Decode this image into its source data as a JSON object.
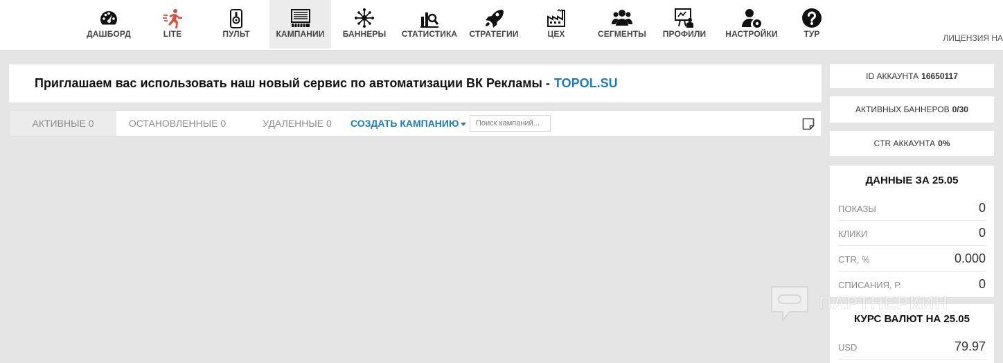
{
  "nav": {
    "items": [
      {
        "label": "ДАШБОРД",
        "icon": "dashboard-gauge-icon"
      },
      {
        "label": "LITE",
        "icon": "runner-icon"
      },
      {
        "label": "ПУЛЬТ",
        "icon": "remote-control-icon"
      },
      {
        "label": "КАМПАНИИ",
        "icon": "campaigns-board-icon",
        "active": true
      },
      {
        "label": "БАННЕРЫ",
        "icon": "banners-network-icon"
      },
      {
        "label": "СТАТИСТИКА",
        "icon": "statistics-chart-icon"
      },
      {
        "label": "СТРАТЕГИИ",
        "icon": "rocket-icon"
      },
      {
        "label": "ЦЕХ",
        "icon": "factory-icon"
      },
      {
        "label": "СЕГМЕНТЫ",
        "icon": "users-group-icon"
      },
      {
        "label": "ПРОФИЛИ",
        "icon": "profile-presentation-icon"
      },
      {
        "label": "НАСТРОЙКИ",
        "icon": "user-settings-icon"
      },
      {
        "label": "ТУР",
        "icon": "question-icon"
      }
    ],
    "license_label": "ЛИЦЕНЗИЯ НА"
  },
  "announcement": {
    "text": "Приглашаем вас использовать наш новый сервис по автоматизации ВК Рекламы -",
    "link": "TOPOL.SU"
  },
  "tabs": {
    "active": "АКТИВНЫЕ 0",
    "stopped": "ОСТАНОВЛЕННЫЕ 0",
    "deleted": "УДАЛЕННЫЕ 0",
    "create": "СОЗДАТЬ КАМПАНИЮ",
    "search_placeholder": "Поиск кампаний..."
  },
  "account": {
    "id_label": "ID АККАУНТА",
    "id_value": "16650117",
    "banners_label": "АКТИВНЫХ БАННЕРОВ",
    "banners_value": "0/30",
    "ctr_label": "CTR АККАУНТА",
    "ctr_value": "0%"
  },
  "day_data": {
    "title": "ДАННЫЕ ЗА 25.05",
    "rows": [
      {
        "label": "ПОКАЗЫ",
        "value": "0"
      },
      {
        "label": "КЛИКИ",
        "value": "0"
      },
      {
        "label": "CTR, %",
        "value": "0.000"
      },
      {
        "label": "СПИСАНИЯ, Р.",
        "value": "0"
      }
    ]
  },
  "currency": {
    "title": "КУРС ВАЛЮТ НА 25.05",
    "rows": [
      {
        "label": "USD",
        "value": "79.97"
      }
    ]
  },
  "watermark": {
    "text": "ПАРТНЕРКИН"
  },
  "colors": {
    "accent": "#1a7bbf",
    "lite_icon": "#e04a3f",
    "background": "#e5e5e5"
  }
}
